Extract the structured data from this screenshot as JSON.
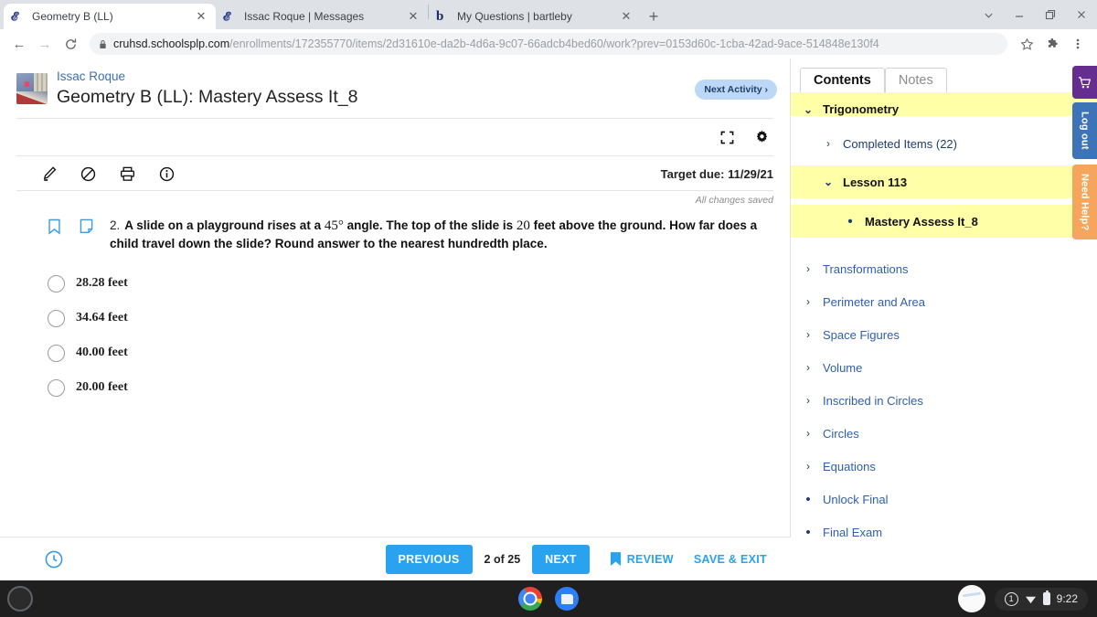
{
  "browser": {
    "tabs": [
      {
        "title": "Geometry B (LL)",
        "favicon": "graduation-cap-icon",
        "active": true
      },
      {
        "title": "Issac Roque | Messages",
        "favicon": "graduation-cap-icon",
        "active": false
      },
      {
        "title": "My Questions | bartleby",
        "favicon": "bartleby-b-icon",
        "active": false
      }
    ],
    "new_tab_label": "+",
    "close_label": "✕",
    "window_controls": [
      "chevron-down-icon",
      "minimize-icon",
      "maximize-icon",
      "close-icon"
    ],
    "nav": {
      "back": "←",
      "forward": "→",
      "reload": "⟳"
    },
    "url_domain": "cruhsd.schoolsplp.com",
    "url_path": "/enrollments/172355770/items/2d31610e-da2b-4d6a-9c07-66adcb4bed60/work?prev=0153d60c-1cba-42ad-9ace-514848e130f4",
    "omnibox_icons": [
      "star-icon",
      "extensions-puzzle-icon",
      "three-dot-menu-icon"
    ]
  },
  "header": {
    "student_name": "Issac Roque",
    "course_title": "Geometry B (LL): Mastery Assess It_8",
    "next_activity_label": "Next Activity ›",
    "view_icons": [
      "fullscreen-icon",
      "settings-gear-icon"
    ],
    "tool_icons": [
      "highlighter-icon",
      "remove-highlight-icon",
      "print-icon",
      "info-icon"
    ],
    "target_due": "Target due: 11/29/21",
    "save_status": "All changes saved"
  },
  "question": {
    "number": "2.",
    "text_before": "A slide on a playground rises at a ",
    "angle": "45°",
    "text_middle": " angle. The top of the slide is ",
    "height": "20",
    "text_after": " feet above the ground. How far does a child travel down the slide? Round answer to the nearest hundredth place.",
    "bookmark_icon": "bookmark-icon",
    "note_icon": "note-icon",
    "options": [
      {
        "label": "28.28 feet",
        "selected": false
      },
      {
        "label": "34.64 feet",
        "selected": false
      },
      {
        "label": "40.00 feet",
        "selected": false
      },
      {
        "label": "20.00 feet",
        "selected": false
      }
    ]
  },
  "bottom_nav": {
    "timer_icon": "clock-icon",
    "previous_label": "PREVIOUS",
    "page_count": "2 of 25",
    "next_label": "NEXT",
    "review_label": "REVIEW",
    "save_exit_label": "SAVE & EXIT"
  },
  "sidebar": {
    "tabs": [
      {
        "label": "Contents",
        "active": true
      },
      {
        "label": "Notes",
        "active": false
      }
    ],
    "items": [
      {
        "label": "Trigonometry",
        "level": 0,
        "marker": "chevron-down",
        "highlighted": true,
        "bold": true,
        "clipped": true
      },
      {
        "label": "Completed Items (22)",
        "level": 1,
        "marker": "chevron-right",
        "highlighted": false,
        "bold": false
      },
      {
        "label": "Lesson 113",
        "level": 1,
        "marker": "chevron-down",
        "highlighted": true,
        "bold": true
      },
      {
        "label": "Mastery Assess It_8",
        "level": 2,
        "marker": "bullet",
        "highlighted": true,
        "bold": true
      },
      {
        "label": "Transformations",
        "level": 0,
        "marker": "chevron-right",
        "highlighted": false,
        "bold": false
      },
      {
        "label": "Perimeter and Area",
        "level": 0,
        "marker": "chevron-right",
        "highlighted": false,
        "bold": false
      },
      {
        "label": "Space Figures",
        "level": 0,
        "marker": "chevron-right",
        "highlighted": false,
        "bold": false
      },
      {
        "label": "Volume",
        "level": 0,
        "marker": "chevron-right",
        "highlighted": false,
        "bold": false
      },
      {
        "label": "Inscribed in Circles",
        "level": 0,
        "marker": "chevron-right",
        "highlighted": false,
        "bold": false
      },
      {
        "label": "Circles",
        "level": 0,
        "marker": "chevron-right",
        "highlighted": false,
        "bold": false
      },
      {
        "label": "Equations",
        "level": 0,
        "marker": "chevron-right",
        "highlighted": false,
        "bold": false
      },
      {
        "label": "Unlock Final",
        "level": 0,
        "marker": "bullet",
        "highlighted": false,
        "bold": false,
        "link": true
      },
      {
        "label": "Final Exam",
        "level": 0,
        "marker": "bullet",
        "highlighted": false,
        "bold": false,
        "link": true
      }
    ],
    "side_tabs": [
      {
        "label": "",
        "name": "cart-tab",
        "color": "#662d91"
      },
      {
        "label": "Log out",
        "name": "logout-tab",
        "color": "#3d74b8"
      },
      {
        "label": "Need Help?",
        "name": "help-tab",
        "color": "#f5a55c"
      }
    ]
  },
  "shelf": {
    "apps": [
      "chrome-icon",
      "files-icon"
    ],
    "notification_count": "1",
    "time": "9:22"
  },
  "colors": {
    "accent_blue": "#29a3f0",
    "highlight_yellow": "#ffffa8",
    "link_blue": "#2f5fa8",
    "next_activity_bg": "#bdd8f7"
  }
}
